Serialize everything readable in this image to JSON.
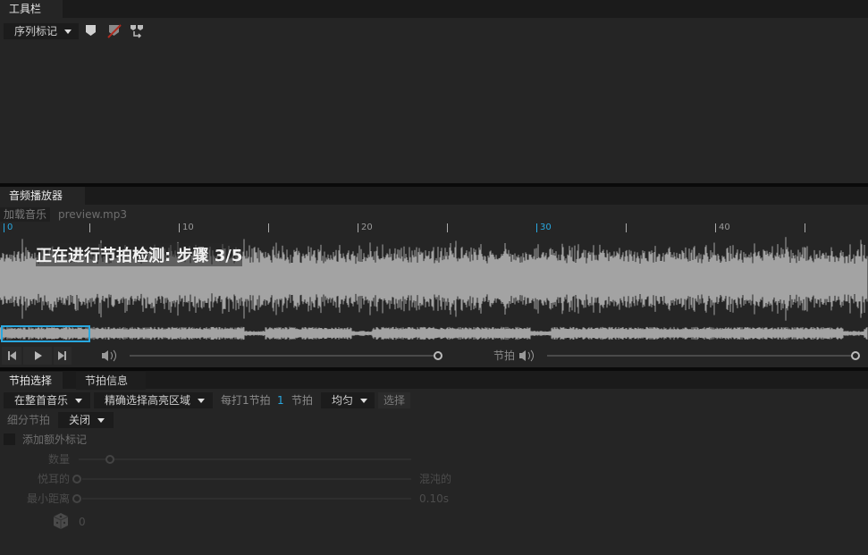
{
  "toolbar_panel": {
    "tab": "工具栏",
    "marker_dropdown": "序列标记"
  },
  "audio_panel": {
    "tab": "音频播放器",
    "load_button": "加载音乐",
    "file_name": "preview.mp3",
    "ruler_labels": [
      "0",
      "10",
      "20",
      "30",
      "40"
    ],
    "status_overlay": "正在进行节拍检测: 步骤 3/5",
    "beat_label": "节拍",
    "volume": 1.0,
    "beat_volume": 1.0,
    "accent_color": "#29a8e0"
  },
  "beat_panel": {
    "tabs": [
      "节拍选择",
      "节拍信息"
    ],
    "scope_dropdown": "在整首音乐",
    "region_dropdown": "精确选择高亮区域",
    "every_label": "每打1节拍",
    "every_value": "1",
    "beat_unit": "节拍",
    "mode_dropdown": "均匀",
    "select_button": "选择",
    "subdivide_label": "细分节拍",
    "subdivide_dropdown": "关闭",
    "extra_marks_label": "添加额外标记",
    "count_label": "数量",
    "pleasant_label": "悦耳的",
    "chaotic_label": "混沌的",
    "min_distance_label": "最小距离",
    "min_distance_value": "0.10s",
    "seed_value": "0"
  }
}
